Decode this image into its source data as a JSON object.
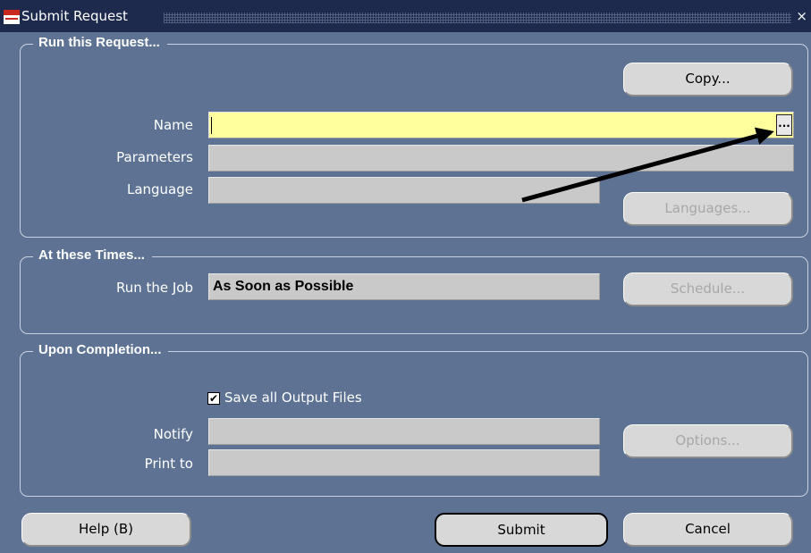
{
  "window": {
    "title": "Submit Request",
    "close_glyph": "×"
  },
  "run_request": {
    "heading": "Run this Request...",
    "copy_label": "Copy...",
    "name_label": "Name",
    "name_value": "",
    "lov_glyph": "...",
    "parameters_label": "Parameters",
    "parameters_value": "",
    "language_label": "Language",
    "language_value": "",
    "languages_label": "Languages..."
  },
  "times": {
    "heading": "At these Times...",
    "run_job_label": "Run the Job",
    "run_job_value": "As Soon as Possible",
    "schedule_label": "Schedule..."
  },
  "completion": {
    "heading": "Upon Completion...",
    "save_files_label": "Save all Output Files",
    "save_files_checked": true,
    "check_glyph": "✔",
    "notify_label": "Notify",
    "notify_value": "",
    "print_to_label": "Print to",
    "print_to_value": "",
    "options_label": "Options..."
  },
  "footer": {
    "help_label": "Help (B)",
    "submit_label": "Submit",
    "cancel_label": "Cancel"
  },
  "icons": {
    "app_logo": "oracle-logo-icon",
    "close": "close-icon",
    "lov": "list-of-values-icon",
    "arrow": "annotation-arrow-icon"
  },
  "colors": {
    "background": "#5e7394",
    "titlebar": "#1d2a4d",
    "field": "#c9c9c9",
    "required_field": "#ffff9d",
    "button": "#d8d8d8",
    "disabled_text": "#a7a7a7"
  }
}
